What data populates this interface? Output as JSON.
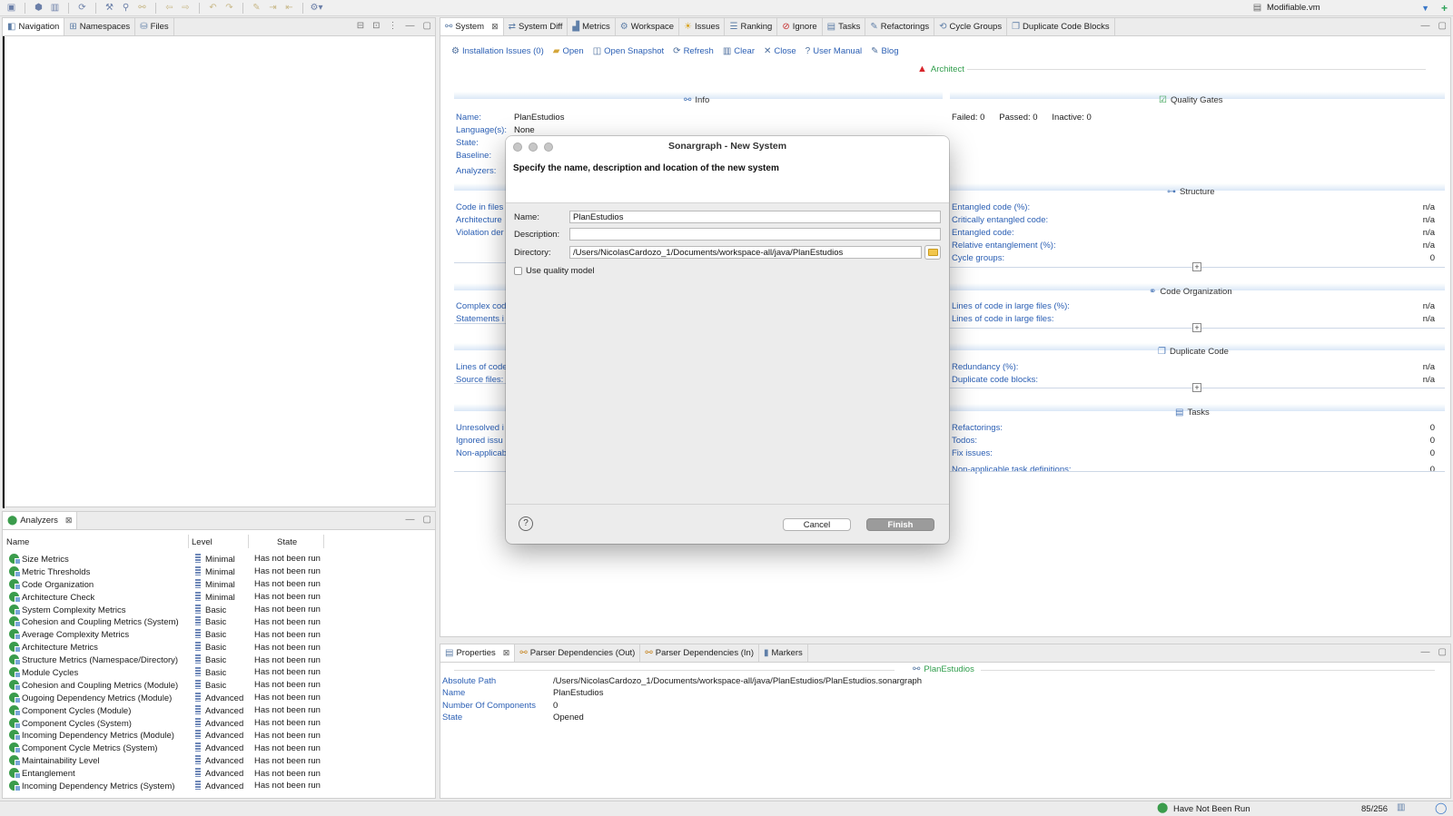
{
  "toolbar": {
    "vm_label": "Modifiable.vm"
  },
  "left_top": {
    "tabs": [
      "Navigation",
      "Namespaces",
      "Files"
    ]
  },
  "main": {
    "tabs": [
      {
        "label": "System",
        "icon": "system-icon"
      },
      {
        "label": "System Diff",
        "icon": "diff-icon"
      },
      {
        "label": "Metrics",
        "icon": "metrics-icon"
      },
      {
        "label": "Workspace",
        "icon": "workspace-icon"
      },
      {
        "label": "Issues",
        "icon": "bulb-icon"
      },
      {
        "label": "Ranking",
        "icon": "ranking-icon"
      },
      {
        "label": "Ignore",
        "icon": "ignore-icon"
      },
      {
        "label": "Tasks",
        "icon": "tasks-icon"
      },
      {
        "label": "Refactorings",
        "icon": "refactor-icon"
      },
      {
        "label": "Cycle Groups",
        "icon": "cycle-icon"
      },
      {
        "label": "Duplicate Code Blocks",
        "icon": "duplicate-icon"
      }
    ],
    "actions": [
      {
        "label": "Installation Issues (0)",
        "icon": "issues-icon"
      },
      {
        "label": "Open",
        "icon": "folder-icon"
      },
      {
        "label": "Open Snapshot",
        "icon": "snapshot-icon"
      },
      {
        "label": "Refresh",
        "icon": "refresh-icon"
      },
      {
        "label": "Clear",
        "icon": "trash-icon"
      },
      {
        "label": "Close",
        "icon": "close-icon"
      },
      {
        "label": "User Manual",
        "icon": "help-icon"
      },
      {
        "label": "Blog",
        "icon": "blog-icon"
      }
    ],
    "architect_label": "Architect",
    "info": {
      "title": "Info",
      "rows": [
        {
          "label": "Name:",
          "value": "PlanEstudios"
        },
        {
          "label": "Language(s):",
          "value": "None"
        },
        {
          "label": "State:",
          "value": ""
        },
        {
          "label": "Baseline:",
          "value": ""
        },
        {
          "label": "Analyzers:",
          "value": ""
        }
      ],
      "partial_rows": [
        "Code in files",
        "Architecture",
        "Violation der",
        "Complex cod",
        "Statements i",
        "Lines of code",
        "Source files:",
        "Unresolved i",
        "Ignored issu",
        "Non-applicab"
      ]
    },
    "quality_gates": {
      "title": "Quality Gates",
      "failed": "Failed:",
      "failed_val": "0",
      "passed": "Passed:",
      "passed_val": "0",
      "inactive": "Inactive:",
      "inactive_val": "0"
    },
    "structure": {
      "title": "Structure",
      "rows": [
        {
          "label": "Entangled code (%):",
          "value": "n/a"
        },
        {
          "label": "Critically entangled code:",
          "value": "n/a"
        },
        {
          "label": "Entangled code:",
          "value": "n/a"
        },
        {
          "label": "Relative entanglement (%):",
          "value": "n/a"
        },
        {
          "label": "Cycle groups:",
          "value": "0"
        }
      ]
    },
    "code_org": {
      "title": "Code Organization",
      "rows": [
        {
          "label": "Lines of code in large files (%):",
          "value": "n/a"
        },
        {
          "label": "Lines of code in large files:",
          "value": "n/a"
        }
      ]
    },
    "duplicate": {
      "title": "Duplicate Code",
      "rows": [
        {
          "label": "Redundancy (%):",
          "value": "n/a"
        },
        {
          "label": "Duplicate code blocks:",
          "value": "n/a"
        }
      ]
    },
    "tasks": {
      "title": "Tasks",
      "rows": [
        {
          "label": "Refactorings:",
          "value": "0"
        },
        {
          "label": "Todos:",
          "value": "0"
        },
        {
          "label": "Fix issues:",
          "value": "0"
        },
        {
          "label": "Non-applicable task definitions:",
          "value": "0"
        }
      ]
    }
  },
  "dialog": {
    "title": "Sonargraph - New System",
    "message": "Specify the name, description and location of the new system",
    "name_label": "Name:",
    "name_value": "PlanEstudios",
    "description_label": "Description:",
    "description_value": "",
    "directory_label": "Directory:",
    "directory_value": "/Users/NicolasCardozo_1/Documents/workspace-all/java/PlanEstudios",
    "use_quality_model": "Use quality model",
    "cancel": "Cancel",
    "finish": "Finish",
    "help": "?"
  },
  "analyzers": {
    "tab": "Analyzers",
    "columns": [
      "Name",
      "Level",
      "State"
    ],
    "rows": [
      {
        "name": "Size Metrics",
        "level": "Minimal",
        "state": "Has not been run"
      },
      {
        "name": "Metric Thresholds",
        "level": "Minimal",
        "state": "Has not been run"
      },
      {
        "name": "Code Organization",
        "level": "Minimal",
        "state": "Has not been run"
      },
      {
        "name": "Architecture Check",
        "level": "Minimal",
        "state": "Has not been run"
      },
      {
        "name": "System Complexity Metrics",
        "level": "Basic",
        "state": "Has not been run"
      },
      {
        "name": "Cohesion and Coupling Metrics (System)",
        "level": "Basic",
        "state": "Has not been run"
      },
      {
        "name": "Average Complexity Metrics",
        "level": "Basic",
        "state": "Has not been run"
      },
      {
        "name": "Architecture Metrics",
        "level": "Basic",
        "state": "Has not been run"
      },
      {
        "name": "Structure Metrics (Namespace/Directory)",
        "level": "Basic",
        "state": "Has not been run"
      },
      {
        "name": "Module Cycles",
        "level": "Basic",
        "state": "Has not been run"
      },
      {
        "name": "Cohesion and Coupling Metrics (Module)",
        "level": "Basic",
        "state": "Has not been run"
      },
      {
        "name": "Ougoing Dependency Metrics (Module)",
        "level": "Advanced",
        "state": "Has not been run"
      },
      {
        "name": "Component Cycles (Module)",
        "level": "Advanced",
        "state": "Has not been run"
      },
      {
        "name": "Component Cycles (System)",
        "level": "Advanced",
        "state": "Has not been run"
      },
      {
        "name": "Incoming Dependency Metrics (Module)",
        "level": "Advanced",
        "state": "Has not been run"
      },
      {
        "name": "Component Cycle Metrics (System)",
        "level": "Advanced",
        "state": "Has not been run"
      },
      {
        "name": "Maintainability Level",
        "level": "Advanced",
        "state": "Has not been run"
      },
      {
        "name": "Entanglement",
        "level": "Advanced",
        "state": "Has not been run"
      },
      {
        "name": "Incoming Dependency Metrics (System)",
        "level": "Advanced",
        "state": "Has not been run"
      }
    ]
  },
  "properties": {
    "tabs": [
      "Properties",
      "Parser Dependencies (Out)",
      "Parser Dependencies (In)",
      "Markers"
    ],
    "header": "PlanEstudios",
    "rows": [
      {
        "key": "Absolute Path",
        "value": "/Users/NicolasCardozo_1/Documents/workspace-all/java/PlanEstudios/PlanEstudios.sonargraph"
      },
      {
        "key": "Name",
        "value": "PlanEstudios"
      },
      {
        "key": "Number Of Components",
        "value": "0"
      },
      {
        "key": "State",
        "value": "Opened"
      }
    ]
  },
  "statusbar": {
    "run_state": "Have Not Been Run",
    "memory": "85/256"
  }
}
